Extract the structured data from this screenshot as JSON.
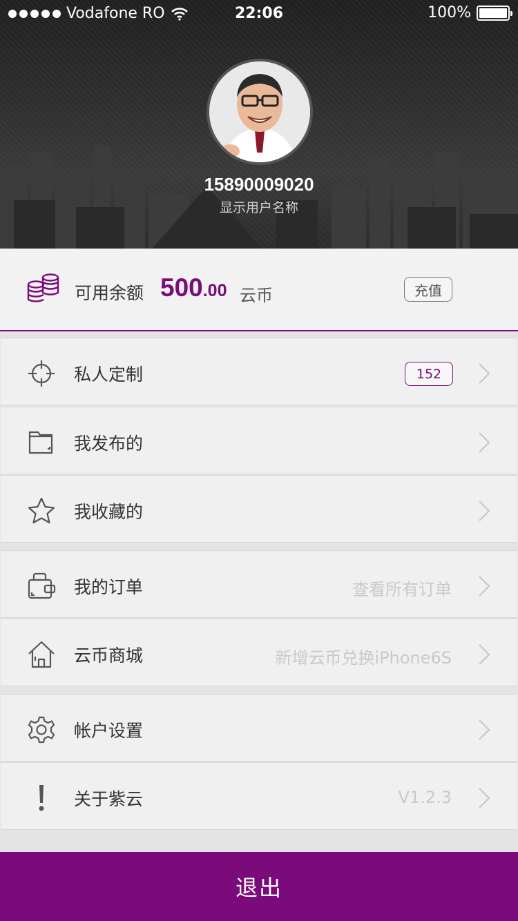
{
  "status_bar": {
    "carrier": "Vodafone RO",
    "time": "22:06",
    "battery": "100%",
    "wifi_icon": "wifi-icon"
  },
  "profile": {
    "phone": "15890009020",
    "display_name": "显示用户名称"
  },
  "balance": {
    "label": "可用余额",
    "amount_int": "500",
    "amount_dec": ".00",
    "unit": "云币",
    "recharge_label": "充值",
    "icon": "coins-icon"
  },
  "menu": {
    "custom": {
      "label": "私人定制",
      "badge": "152",
      "icon": "crosshair-icon"
    },
    "published": {
      "label": "我发布的",
      "icon": "folder-icon"
    },
    "favorites": {
      "label": "我收藏的",
      "icon": "star-icon"
    },
    "orders": {
      "label": "我的订单",
      "hint": "查看所有订单",
      "icon": "wallet-icon"
    },
    "mall": {
      "label": "云币商城",
      "hint": "新增云币兑换iPhone6S",
      "icon": "home-icon"
    },
    "settings": {
      "label": "帐户设置",
      "icon": "gear-icon"
    },
    "about": {
      "label": "关于紫云",
      "hint": "V1.2.3",
      "icon": "exclamation-icon"
    }
  },
  "logout_label": "退出",
  "colors": {
    "accent": "#7b0b7a",
    "row_bg": "#f0f0f0",
    "page_bg": "#e4e4e4",
    "hint": "#c9c9c9"
  }
}
